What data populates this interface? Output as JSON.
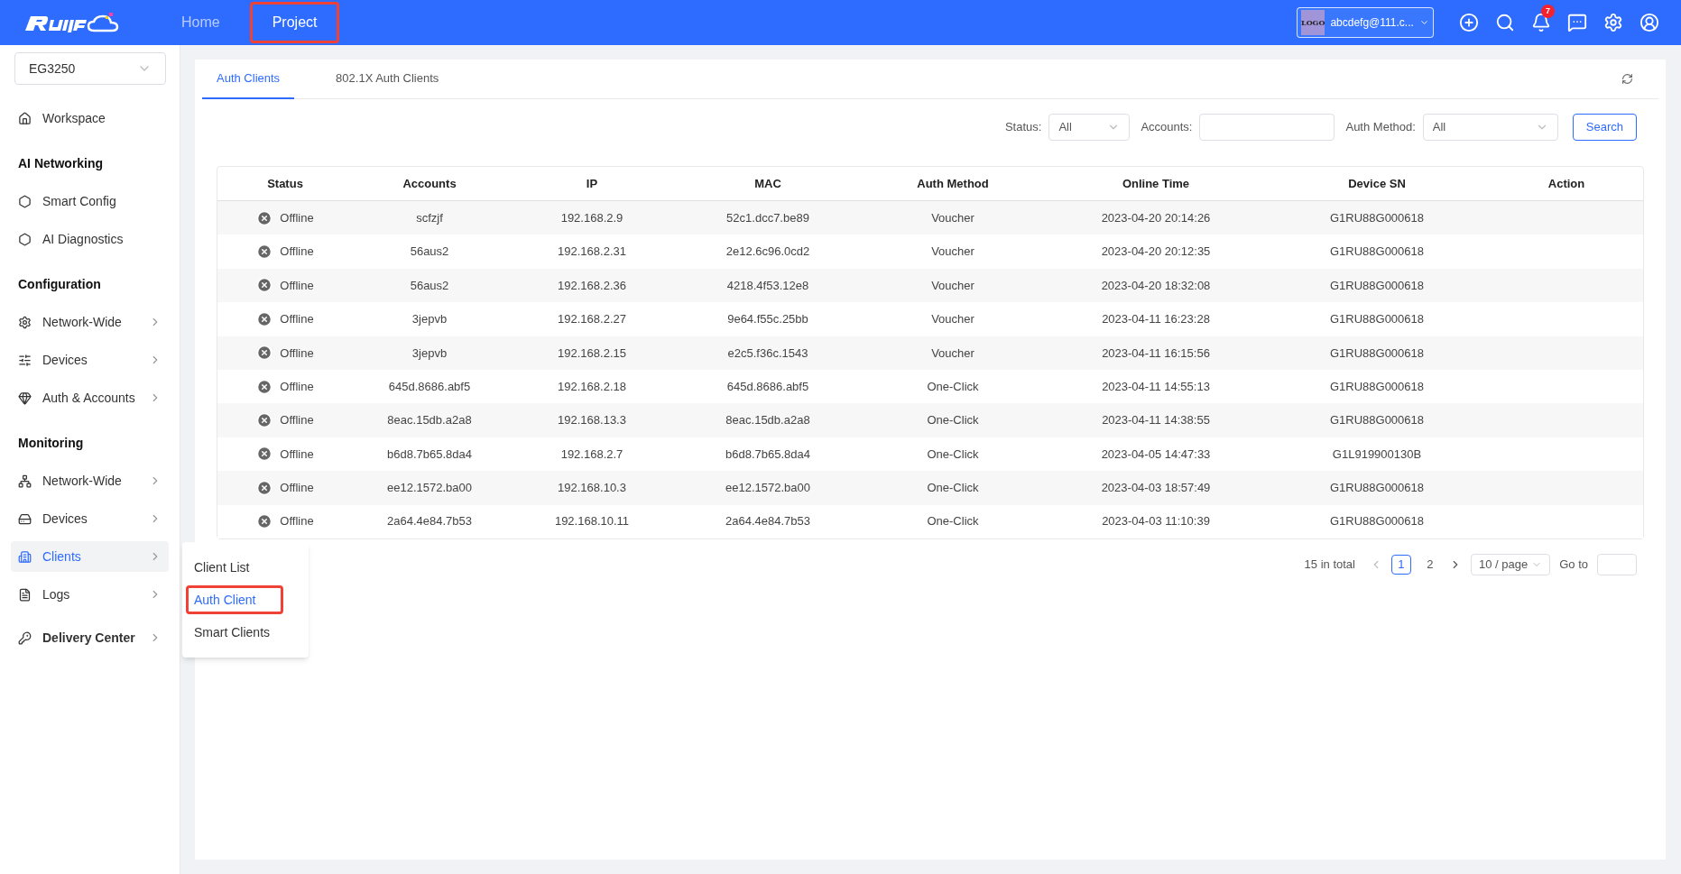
{
  "header": {
    "nav": [
      {
        "label": "Home",
        "selected": false,
        "highlighted": false
      },
      {
        "label": "Project",
        "selected": true,
        "highlighted": true
      }
    ],
    "account": {
      "logo": "LOGO",
      "email": "abcdefg@111.c..."
    },
    "notifications": "7"
  },
  "sidebar": {
    "device": "EG3250",
    "items": [
      {
        "kind": "item",
        "label": "Workspace",
        "arrow": false,
        "selected": false
      },
      {
        "kind": "section",
        "label": "AI Networking"
      },
      {
        "kind": "item",
        "label": "Smart Config",
        "arrow": false,
        "selected": false
      },
      {
        "kind": "item",
        "label": "AI Diagnostics",
        "arrow": false,
        "selected": false
      },
      {
        "kind": "section",
        "label": "Configuration"
      },
      {
        "kind": "item",
        "label": "Network-Wide",
        "arrow": true,
        "selected": false
      },
      {
        "kind": "item",
        "label": "Devices",
        "arrow": true,
        "selected": false
      },
      {
        "kind": "item",
        "label": "Auth & Accounts",
        "arrow": true,
        "selected": false
      },
      {
        "kind": "section",
        "label": "Monitoring"
      },
      {
        "kind": "item",
        "label": "Network-Wide",
        "arrow": true,
        "selected": false
      },
      {
        "kind": "item",
        "label": "Devices",
        "arrow": true,
        "selected": false
      },
      {
        "kind": "item",
        "label": "Clients",
        "arrow": true,
        "selected": true
      },
      {
        "kind": "item",
        "label": "Logs",
        "arrow": true,
        "selected": false
      },
      {
        "kind": "bold",
        "label": "Delivery Center",
        "arrow": true,
        "selected": false
      }
    ],
    "submenu": [
      {
        "label": "Client List",
        "selected": false,
        "highlighted": false
      },
      {
        "label": "Auth Client",
        "selected": true,
        "highlighted": true
      },
      {
        "label": "Smart Clients",
        "selected": false,
        "highlighted": false
      }
    ]
  },
  "tabs": [
    {
      "label": "Auth Clients",
      "selected": true
    },
    {
      "label": "802.1X Auth Clients",
      "selected": false
    }
  ],
  "filters": {
    "status_label": "Status:",
    "status_value": "All",
    "accounts_label": "Accounts:",
    "auth_label": "Auth Method:",
    "auth_value": "All",
    "search": "Search"
  },
  "table": {
    "columns": [
      "Status",
      "Accounts",
      "IP",
      "MAC",
      "Auth Method",
      "Online Time",
      "Device SN",
      "Action"
    ],
    "rows": [
      [
        "Offline",
        "scfzjf",
        "192.168.2.9",
        "52c1.dcc7.be89",
        "Voucher",
        "2023-04-20 20:14:26",
        "G1RU88G000618"
      ],
      [
        "Offline",
        "56aus2",
        "192.168.2.31",
        "2e12.6c96.0cd2",
        "Voucher",
        "2023-04-20 20:12:35",
        "G1RU88G000618"
      ],
      [
        "Offline",
        "56aus2",
        "192.168.2.36",
        "4218.4f53.12e8",
        "Voucher",
        "2023-04-20 18:32:08",
        "G1RU88G000618"
      ],
      [
        "Offline",
        "3jepvb",
        "192.168.2.27",
        "9e64.f55c.25bb",
        "Voucher",
        "2023-04-11 16:23:28",
        "G1RU88G000618"
      ],
      [
        "Offline",
        "3jepvb",
        "192.168.2.15",
        "e2c5.f36c.1543",
        "Voucher",
        "2023-04-11 16:15:56",
        "G1RU88G000618"
      ],
      [
        "Offline",
        "645d.8686.abf5",
        "192.168.2.18",
        "645d.8686.abf5",
        "One-Click",
        "2023-04-11 14:55:13",
        "G1RU88G000618"
      ],
      [
        "Offline",
        "8eac.15db.a2a8",
        "192.168.13.3",
        "8eac.15db.a2a8",
        "One-Click",
        "2023-04-11 14:38:55",
        "G1RU88G000618"
      ],
      [
        "Offline",
        "b6d8.7b65.8da4",
        "192.168.2.7",
        "b6d8.7b65.8da4",
        "One-Click",
        "2023-04-05 14:47:33",
        "G1L919900130B"
      ],
      [
        "Offline",
        "ee12.1572.ba00",
        "192.168.10.3",
        "ee12.1572.ba00",
        "One-Click",
        "2023-04-03 18:57:49",
        "G1RU88G000618"
      ],
      [
        "Offline",
        "2a64.4e84.7b53",
        "192.168.10.11",
        "2a64.4e84.7b53",
        "One-Click",
        "2023-04-03 11:10:39",
        "G1RU88G000618"
      ]
    ]
  },
  "pagination": {
    "total": "15 in total",
    "pages": [
      {
        "label": "1",
        "selected": true
      },
      {
        "label": "2",
        "selected": false
      }
    ],
    "page_size": "10 / page",
    "goto": "Go to"
  }
}
